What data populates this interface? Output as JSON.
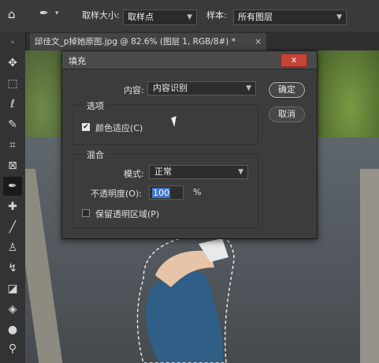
{
  "optionsbar": {
    "sample_size_label": "取样大小:",
    "sample_size_value": "取样点",
    "sample_label": "样本:",
    "sample_value": "所有图层"
  },
  "document_tab": {
    "title": "邱佳文_p掉她原图.jpg @ 82.6% (图层 1, RGB/8#) *",
    "close": "×"
  },
  "dialog": {
    "title": "填充",
    "close": "x",
    "content_label": "内容:",
    "content_value": "内容识别",
    "ok_label": "确定",
    "cancel_label": "取消",
    "options_group_title": "选项",
    "color_adapt_label": "颜色适应(C)",
    "color_adapt_checked": true,
    "blend_group_title": "混合",
    "mode_label": "模式:",
    "mode_value": "正常",
    "opacity_label": "不透明度(O):",
    "opacity_value": "100",
    "opacity_unit": "%",
    "preserve_label": "保留透明区域(P)",
    "preserve_checked": false
  },
  "colors": {
    "close_button": "#c64436",
    "selection_highlight": "#3d75c9"
  }
}
